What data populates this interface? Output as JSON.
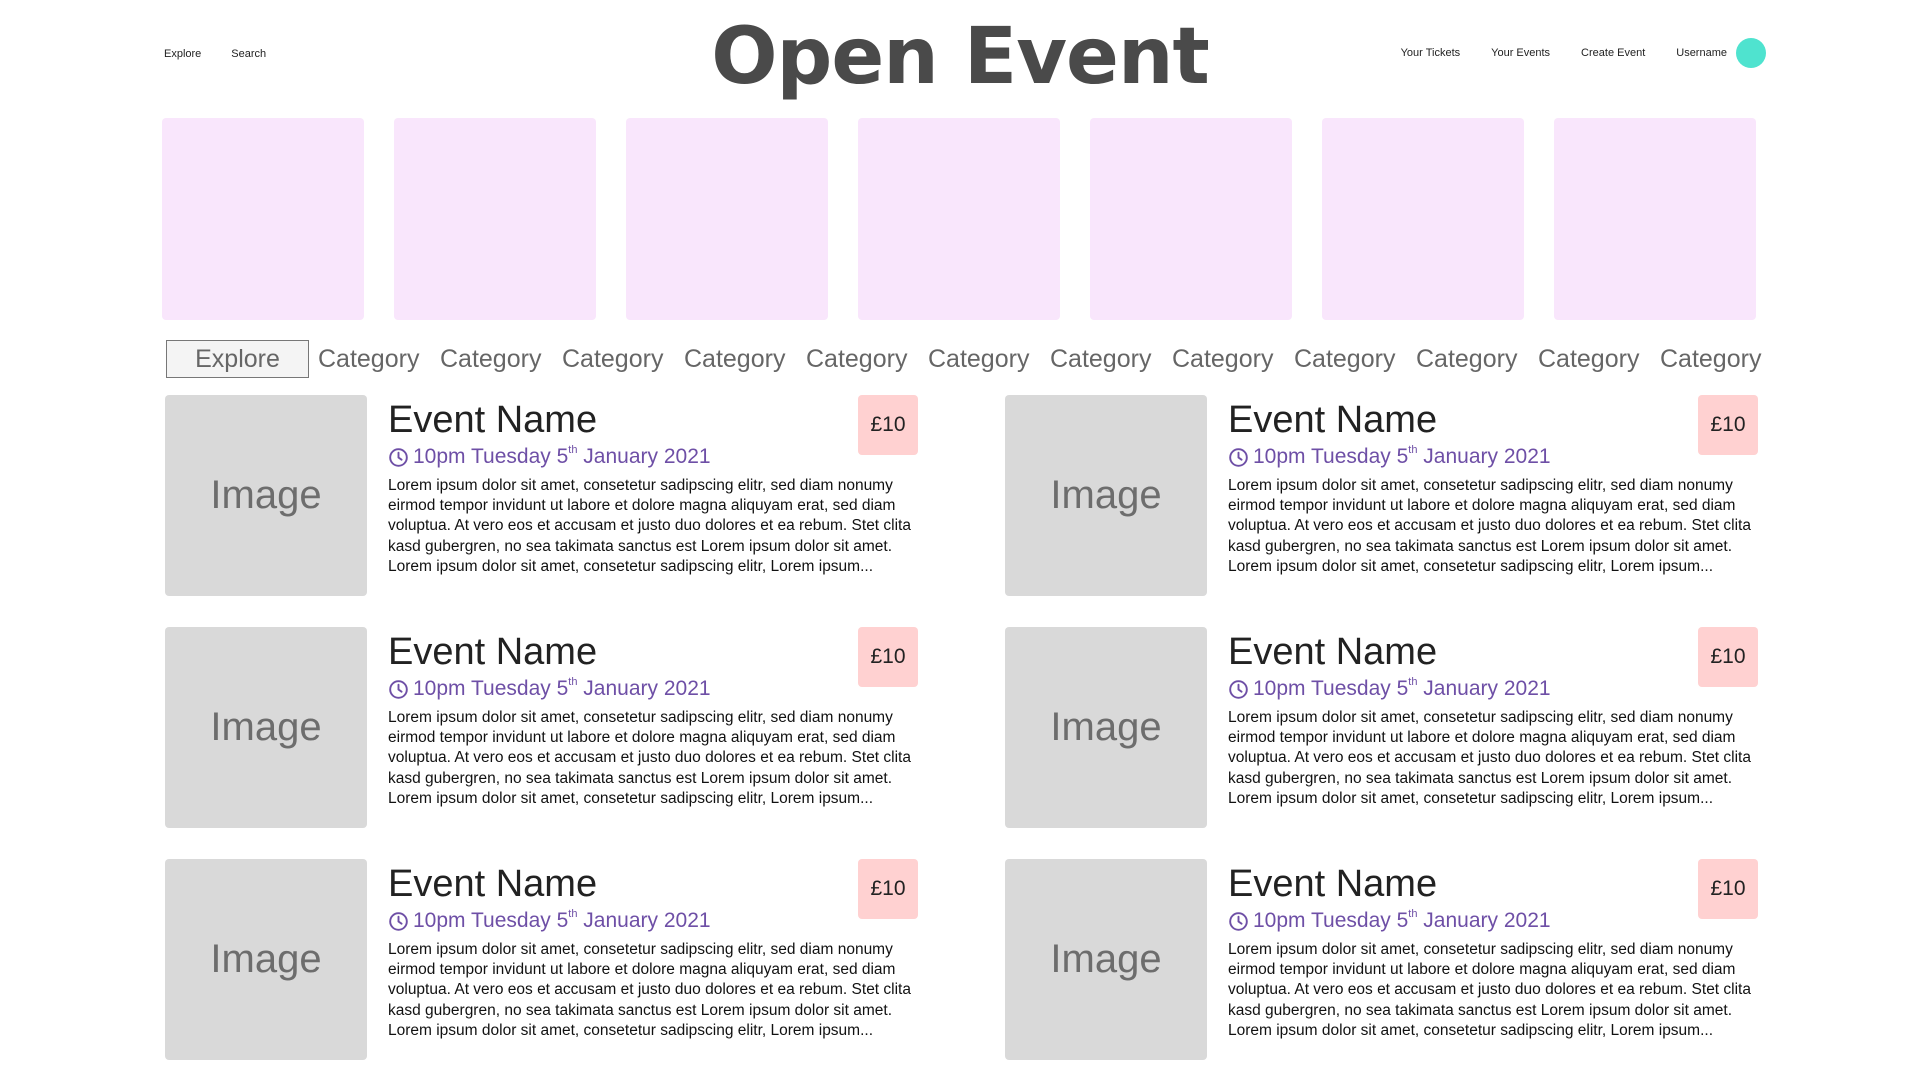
{
  "header": {
    "nav_left": [
      "Explore",
      "Search"
    ],
    "logo": "Open Event",
    "nav_right": [
      "Your Tickets",
      "Your Events",
      "Create Event"
    ],
    "username": "Username",
    "avatar_color": "#4fe3cf"
  },
  "featured": {
    "tile_count": 7,
    "tile_color": "#f9e6fc"
  },
  "categories": {
    "active": "Explore",
    "items": [
      "Category",
      "Category",
      "Category",
      "Category",
      "Category",
      "Category",
      "Category",
      "Category",
      "Category",
      "Category",
      "Category",
      "Category"
    ]
  },
  "events": [
    {
      "image_label": "Image",
      "name": "Event Name",
      "date_pre": "10pm Tuesday 5",
      "date_sup": "th",
      "date_post": "January 2021",
      "price": "£10",
      "description": "Lorem ipsum dolor sit amet, consetetur sadipscing elitr, sed diam nonumy eirmod tempor invidunt ut labore et dolore magna aliquyam erat, sed diam voluptua. At vero eos et accusam et justo duo dolores et ea rebum. Stet clita kasd gubergren, no sea takimata sanctus est Lorem ipsum dolor sit amet. Lorem ipsum dolor sit amet, consetetur sadipscing elitr, Lorem ipsum..."
    },
    {
      "image_label": "Image",
      "name": "Event Name",
      "date_pre": "10pm Tuesday 5",
      "date_sup": "th",
      "date_post": "January 2021",
      "price": "£10",
      "description": "Lorem ipsum dolor sit amet, consetetur sadipscing elitr, sed diam nonumy eirmod tempor invidunt ut labore et dolore magna aliquyam erat, sed diam voluptua. At vero eos et accusam et justo duo dolores et ea rebum. Stet clita kasd gubergren, no sea takimata sanctus est Lorem ipsum dolor sit amet. Lorem ipsum dolor sit amet, consetetur sadipscing elitr, Lorem ipsum..."
    },
    {
      "image_label": "Image",
      "name": "Event Name",
      "date_pre": "10pm Tuesday 5",
      "date_sup": "th",
      "date_post": "January 2021",
      "price": "£10",
      "description": "Lorem ipsum dolor sit amet, consetetur sadipscing elitr, sed diam nonumy eirmod tempor invidunt ut labore et dolore magna aliquyam erat, sed diam voluptua. At vero eos et accusam et justo duo dolores et ea rebum. Stet clita kasd gubergren, no sea takimata sanctus est Lorem ipsum dolor sit amet. Lorem ipsum dolor sit amet, consetetur sadipscing elitr, Lorem ipsum..."
    },
    {
      "image_label": "Image",
      "name": "Event Name",
      "date_pre": "10pm Tuesday 5",
      "date_sup": "th",
      "date_post": "January 2021",
      "price": "£10",
      "description": "Lorem ipsum dolor sit amet, consetetur sadipscing elitr, sed diam nonumy eirmod tempor invidunt ut labore et dolore magna aliquyam erat, sed diam voluptua. At vero eos et accusam et justo duo dolores et ea rebum. Stet clita kasd gubergren, no sea takimata sanctus est Lorem ipsum dolor sit amet. Lorem ipsum dolor sit amet, consetetur sadipscing elitr, Lorem ipsum..."
    },
    {
      "image_label": "Image",
      "name": "Event Name",
      "date_pre": "10pm Tuesday 5",
      "date_sup": "th",
      "date_post": "January 2021",
      "price": "£10",
      "description": "Lorem ipsum dolor sit amet, consetetur sadipscing elitr, sed diam nonumy eirmod tempor invidunt ut labore et dolore magna aliquyam erat, sed diam voluptua. At vero eos et accusam et justo duo dolores et ea rebum. Stet clita kasd gubergren, no sea takimata sanctus est Lorem ipsum dolor sit amet. Lorem ipsum dolor sit amet, consetetur sadipscing elitr, Lorem ipsum..."
    },
    {
      "image_label": "Image",
      "name": "Event Name",
      "date_pre": "10pm Tuesday 5",
      "date_sup": "th",
      "date_post": "January 2021",
      "price": "£10",
      "description": "Lorem ipsum dolor sit amet, consetetur sadipscing elitr, sed diam nonumy eirmod tempor invidunt ut labore et dolore magna aliquyam erat, sed diam voluptua. At vero eos et accusam et justo duo dolores et ea rebum. Stet clita kasd gubergren, no sea takimata sanctus est Lorem ipsum dolor sit amet. Lorem ipsum dolor sit amet, consetetur sadipscing elitr, Lorem ipsum..."
    }
  ],
  "colors": {
    "logo": "#4a4a4a",
    "date_accent": "#6e4fa6",
    "price_bg": "#ffd1d1",
    "image_placeholder": "#d9d9d9"
  },
  "icons": {
    "date": "clock-icon"
  }
}
